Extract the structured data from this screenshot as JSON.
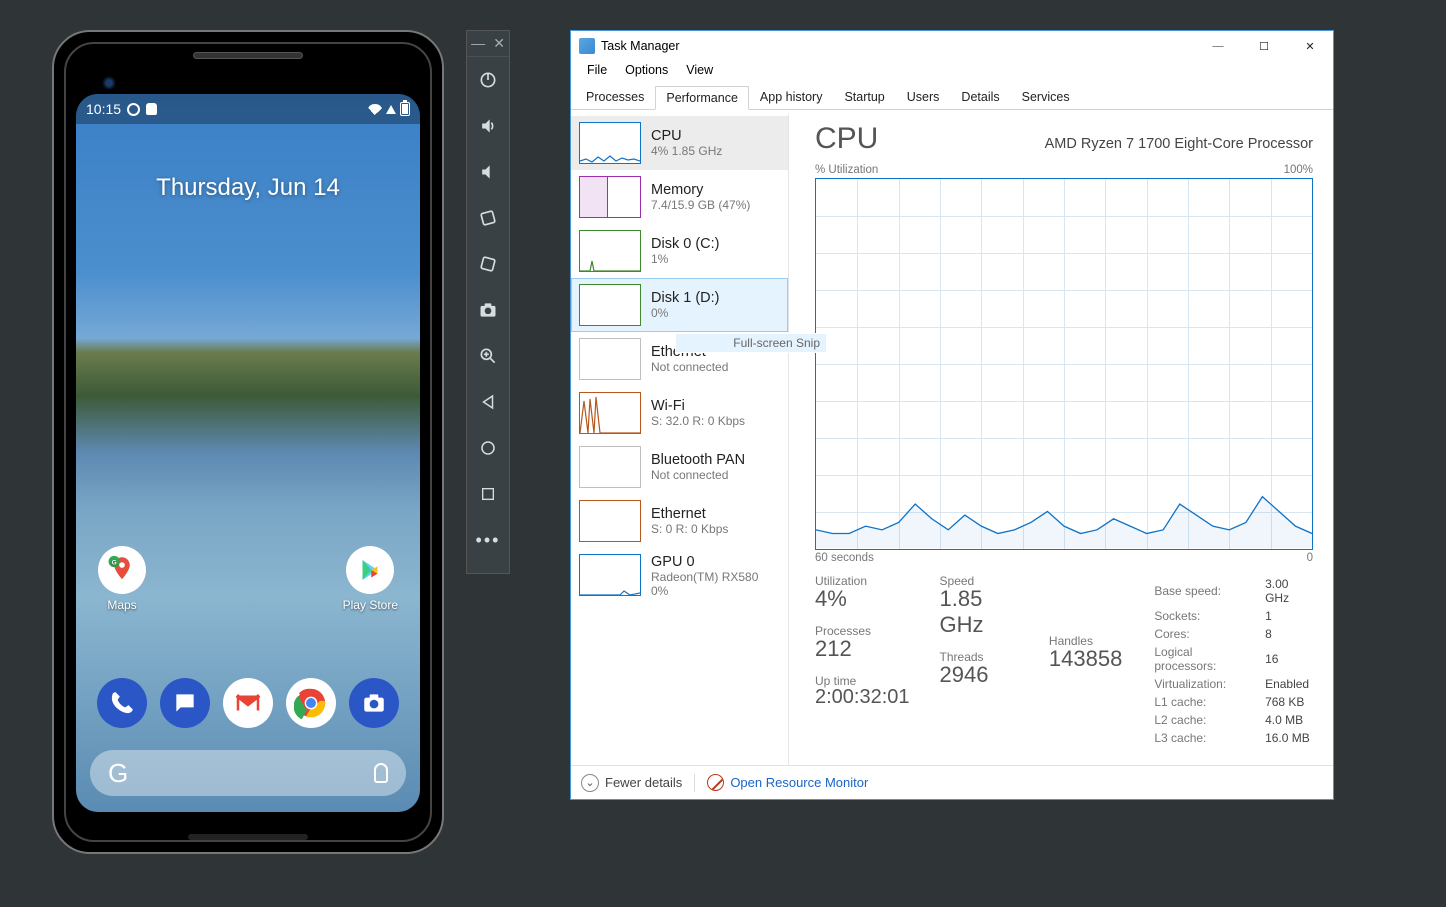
{
  "phone": {
    "status": {
      "time": "10:15"
    },
    "date": "Thursday, Jun 14",
    "apps": {
      "maps": "Maps",
      "play": "Play Store"
    },
    "search_letter": "G"
  },
  "emu_toolbar": {
    "items": [
      "power",
      "vol-up",
      "vol-down",
      "rotate-ccw",
      "rotate-cw",
      "camera",
      "zoom",
      "back",
      "home",
      "overview",
      "more"
    ]
  },
  "tm": {
    "title": "Task Manager",
    "menu": {
      "file": "File",
      "options": "Options",
      "view": "View"
    },
    "tabs": [
      "Processes",
      "Performance",
      "App history",
      "Startup",
      "Users",
      "Details",
      "Services"
    ],
    "active_tab": "Performance",
    "snip_tooltip": "Full-screen Snip",
    "tiles": [
      {
        "title": "CPU",
        "sub": "4% 1.85 GHz",
        "color": "#1073c6"
      },
      {
        "title": "Memory",
        "sub": "7.4/15.9 GB (47%)",
        "color": "#9b2fae"
      },
      {
        "title": "Disk 0 (C:)",
        "sub": "1%",
        "color": "#3f8a2f"
      },
      {
        "title": "Disk 1 (D:)",
        "sub": "0%",
        "color": "#3f8a2f"
      },
      {
        "title": "Ethernet",
        "sub": "Not connected",
        "color": "#bfbfbf"
      },
      {
        "title": "Wi-Fi",
        "sub": "S: 32.0  R: 0 Kbps",
        "color": "#b6571b"
      },
      {
        "title": "Bluetooth PAN",
        "sub": "Not connected",
        "color": "#bfbfbf"
      },
      {
        "title": "Ethernet",
        "sub": "S: 0  R: 0 Kbps",
        "color": "#b6571b"
      },
      {
        "title": "GPU 0",
        "sub": "Radeon(TM) RX580\n0%",
        "color": "#1073c6"
      }
    ],
    "cpu": {
      "heading": "CPU",
      "model": "AMD Ryzen 7 1700 Eight-Core Processor",
      "util_label": "% Utilization",
      "max_label": "100%",
      "x_left": "60 seconds",
      "x_right": "0",
      "stats": {
        "utilization_label": "Utilization",
        "utilization_val": "4%",
        "speed_label": "Speed",
        "speed_val": "1.85 GHz",
        "processes_label": "Processes",
        "processes_val": "212",
        "threads_label": "Threads",
        "threads_val": "2946",
        "handles_label": "Handles",
        "handles_val": "143858",
        "uptime_label": "Up time",
        "uptime_val": "2:00:32:01"
      },
      "right_stats": [
        [
          "Base speed:",
          "3.00 GHz"
        ],
        [
          "Sockets:",
          "1"
        ],
        [
          "Cores:",
          "8"
        ],
        [
          "Logical processors:",
          "16"
        ],
        [
          "Virtualization:",
          "Enabled"
        ],
        [
          "L1 cache:",
          "768 KB"
        ],
        [
          "L2 cache:",
          "4.0 MB"
        ],
        [
          "L3 cache:",
          "16.0 MB"
        ]
      ]
    },
    "footer": {
      "fewer": "Fewer details",
      "orm": "Open Resource Monitor"
    }
  },
  "chart_data": {
    "type": "line",
    "title": "% Utilization",
    "xlabel": "seconds",
    "ylabel": "% Utilization",
    "ylim": [
      0,
      100
    ],
    "xlim": [
      60,
      0
    ],
    "x": [
      60,
      58,
      56,
      54,
      52,
      50,
      48,
      46,
      44,
      42,
      40,
      38,
      36,
      34,
      32,
      30,
      28,
      26,
      24,
      22,
      20,
      18,
      16,
      14,
      12,
      10,
      8,
      6,
      4,
      2,
      0
    ],
    "values": [
      5,
      4,
      4,
      6,
      5,
      7,
      12,
      8,
      5,
      9,
      6,
      4,
      5,
      7,
      10,
      6,
      4,
      5,
      8,
      6,
      4,
      5,
      12,
      9,
      6,
      5,
      7,
      14,
      10,
      6,
      4
    ]
  }
}
